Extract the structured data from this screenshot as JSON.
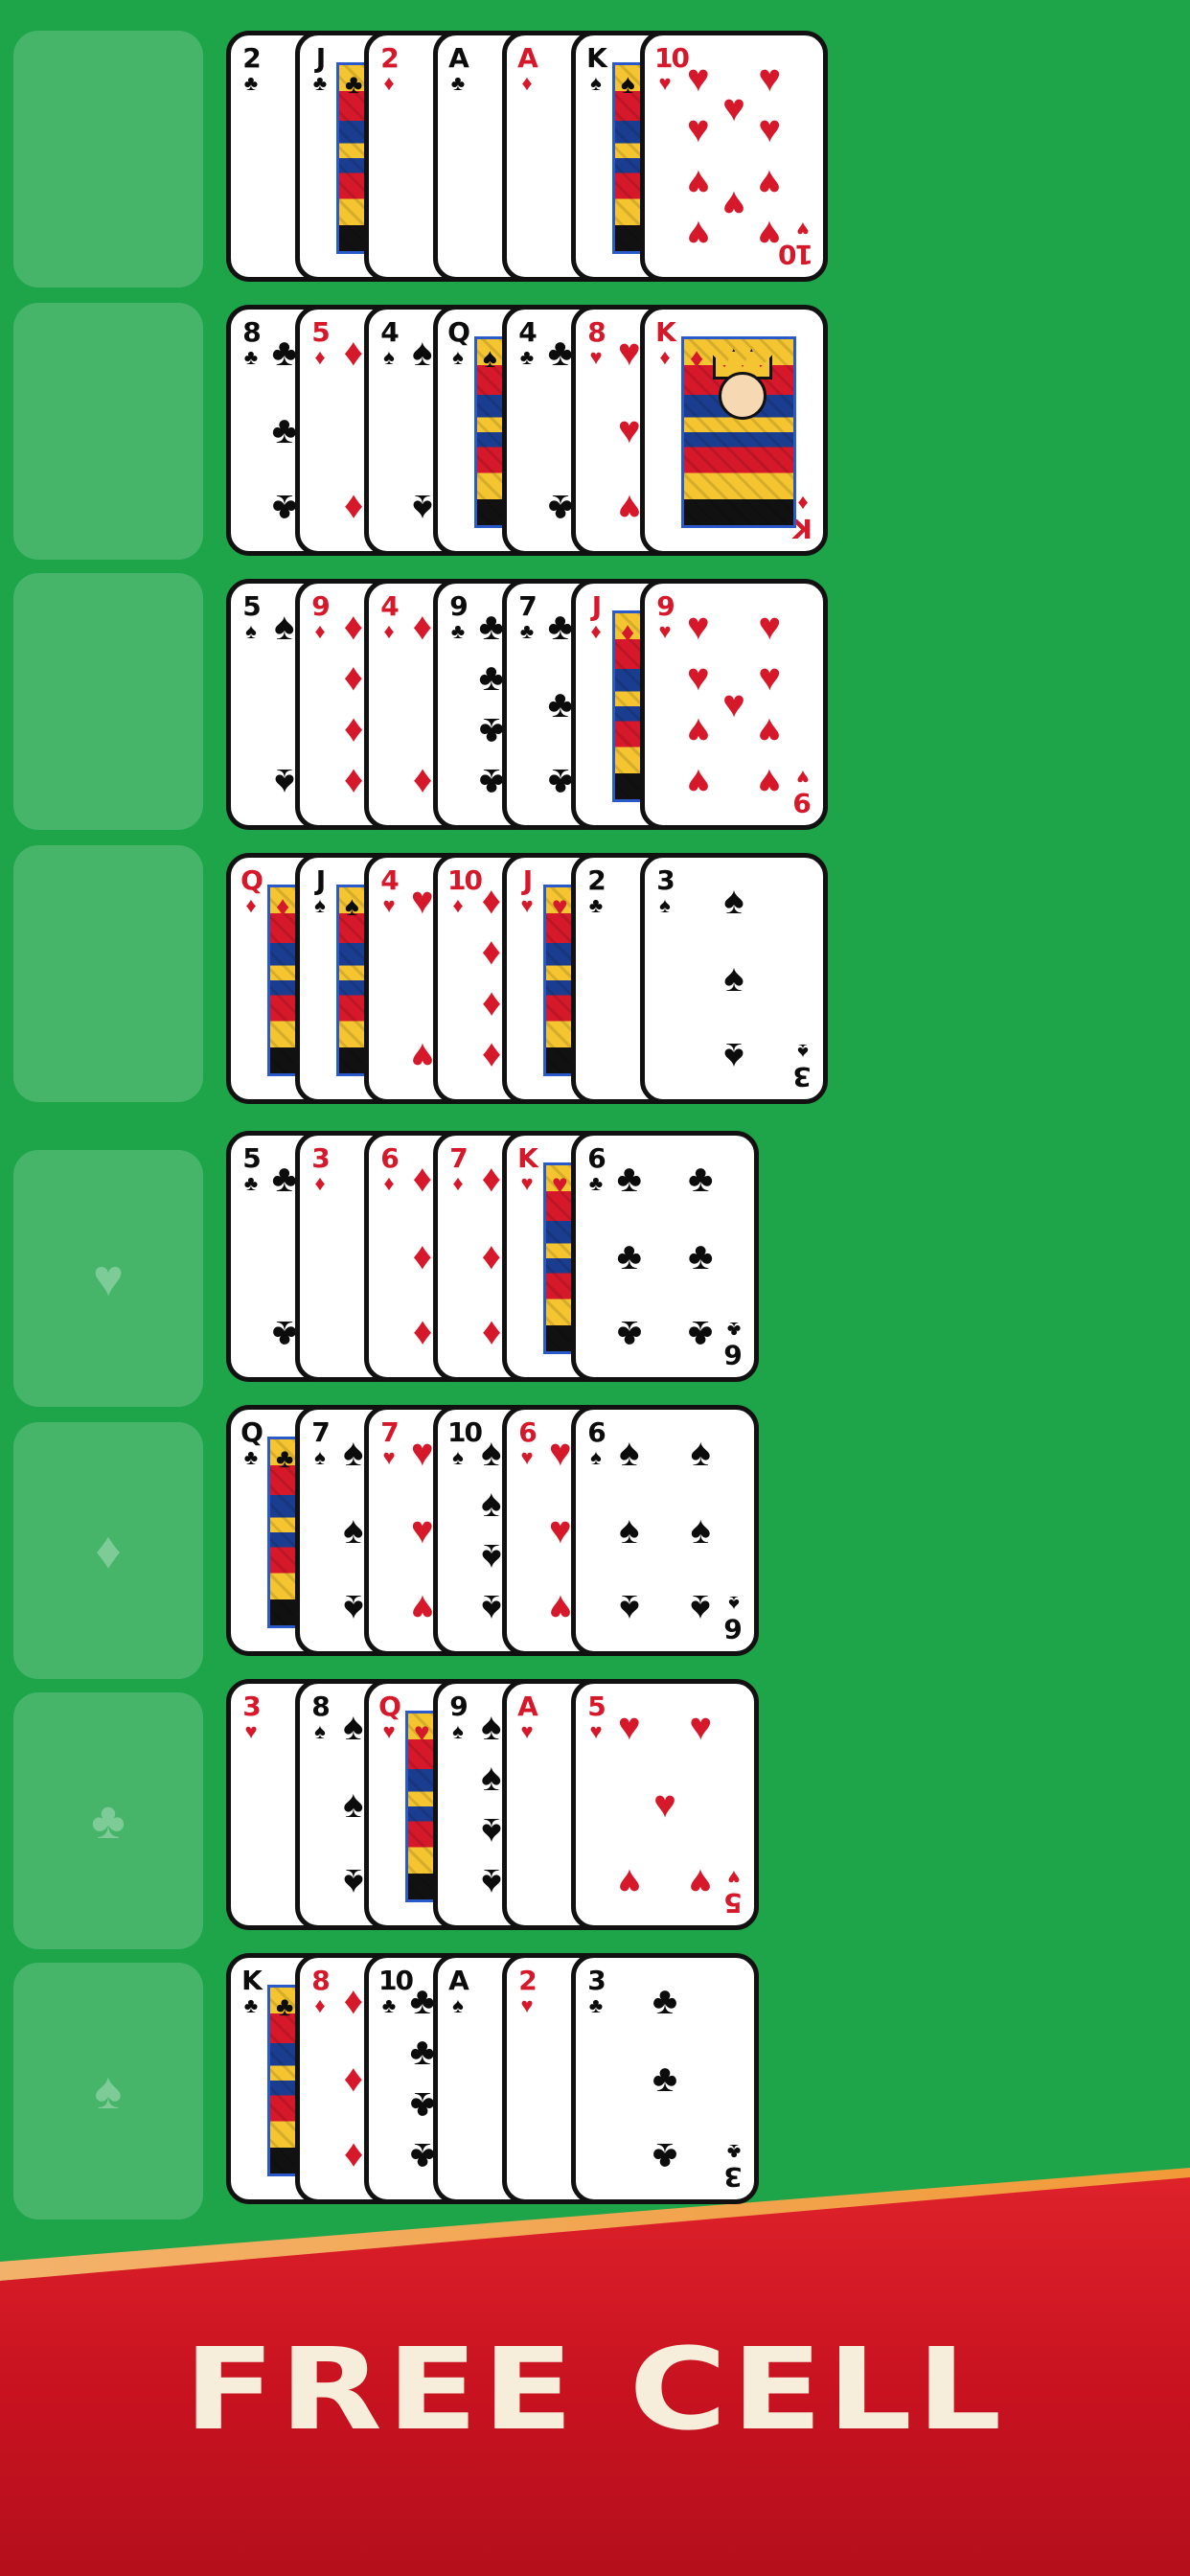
{
  "colors": {
    "felt": "#1ea54a",
    "red_suit": "#d6182b",
    "black_suit": "#0c0c0c",
    "banner": "#c81220",
    "banner_text": "#f6eddb"
  },
  "foundations": [
    {
      "suit": "",
      "suit_icon": ""
    },
    {
      "suit": "",
      "suit_icon": ""
    },
    {
      "suit": "",
      "suit_icon": ""
    },
    {
      "suit": "",
      "suit_icon": ""
    },
    {
      "suit": "♥",
      "suit_icon": "heart-icon"
    },
    {
      "suit": "♦",
      "suit_icon": "diamond-icon"
    },
    {
      "suit": "♣",
      "suit_icon": "club-icon"
    },
    {
      "suit": "♠",
      "suit_icon": "spade-icon"
    }
  ],
  "tableau": [
    [
      {
        "rank": "2",
        "suit": "♣"
      },
      {
        "rank": "J",
        "suit": "♣"
      },
      {
        "rank": "2",
        "suit": "♦"
      },
      {
        "rank": "A",
        "suit": "♣"
      },
      {
        "rank": "A",
        "suit": "♦"
      },
      {
        "rank": "K",
        "suit": "♠"
      },
      {
        "rank": "10",
        "suit": "♥"
      }
    ],
    [
      {
        "rank": "8",
        "suit": "♣"
      },
      {
        "rank": "5",
        "suit": "♦"
      },
      {
        "rank": "4",
        "suit": "♠"
      },
      {
        "rank": "Q",
        "suit": "♠"
      },
      {
        "rank": "4",
        "suit": "♣"
      },
      {
        "rank": "8",
        "suit": "♥"
      },
      {
        "rank": "K",
        "suit": "♦"
      }
    ],
    [
      {
        "rank": "5",
        "suit": "♠"
      },
      {
        "rank": "9",
        "suit": "♦"
      },
      {
        "rank": "4",
        "suit": "♦"
      },
      {
        "rank": "9",
        "suit": "♣"
      },
      {
        "rank": "7",
        "suit": "♣"
      },
      {
        "rank": "J",
        "suit": "♦"
      },
      {
        "rank": "9",
        "suit": "♥"
      }
    ],
    [
      {
        "rank": "Q",
        "suit": "♦"
      },
      {
        "rank": "J",
        "suit": "♠"
      },
      {
        "rank": "4",
        "suit": "♥"
      },
      {
        "rank": "10",
        "suit": "♦"
      },
      {
        "rank": "J",
        "suit": "♥"
      },
      {
        "rank": "2",
        "suit": "♣"
      },
      {
        "rank": "3",
        "suit": "♠"
      }
    ],
    [
      {
        "rank": "5",
        "suit": "♣"
      },
      {
        "rank": "3",
        "suit": "♦"
      },
      {
        "rank": "6",
        "suit": "♦"
      },
      {
        "rank": "7",
        "suit": "♦"
      },
      {
        "rank": "K",
        "suit": "♥"
      },
      {
        "rank": "6",
        "suit": "♣"
      }
    ],
    [
      {
        "rank": "Q",
        "suit": "♣"
      },
      {
        "rank": "7",
        "suit": "♠"
      },
      {
        "rank": "7",
        "suit": "♥"
      },
      {
        "rank": "10",
        "suit": "♠"
      },
      {
        "rank": "6",
        "suit": "♥"
      },
      {
        "rank": "6",
        "suit": "♠"
      }
    ],
    [
      {
        "rank": "3",
        "suit": "♥"
      },
      {
        "rank": "8",
        "suit": "♠"
      },
      {
        "rank": "Q",
        "suit": "♥"
      },
      {
        "rank": "9",
        "suit": "♠"
      },
      {
        "rank": "A",
        "suit": "♥"
      },
      {
        "rank": "5",
        "suit": "♥"
      }
    ],
    [
      {
        "rank": "K",
        "suit": "♣"
      },
      {
        "rank": "8",
        "suit": "♦"
      },
      {
        "rank": "10",
        "suit": "♣"
      },
      {
        "rank": "A",
        "suit": "♠"
      },
      {
        "rank": "2",
        "suit": "♥"
      },
      {
        "rank": "3",
        "suit": "♣"
      }
    ]
  ],
  "banner": {
    "title": "FREE CELL"
  }
}
